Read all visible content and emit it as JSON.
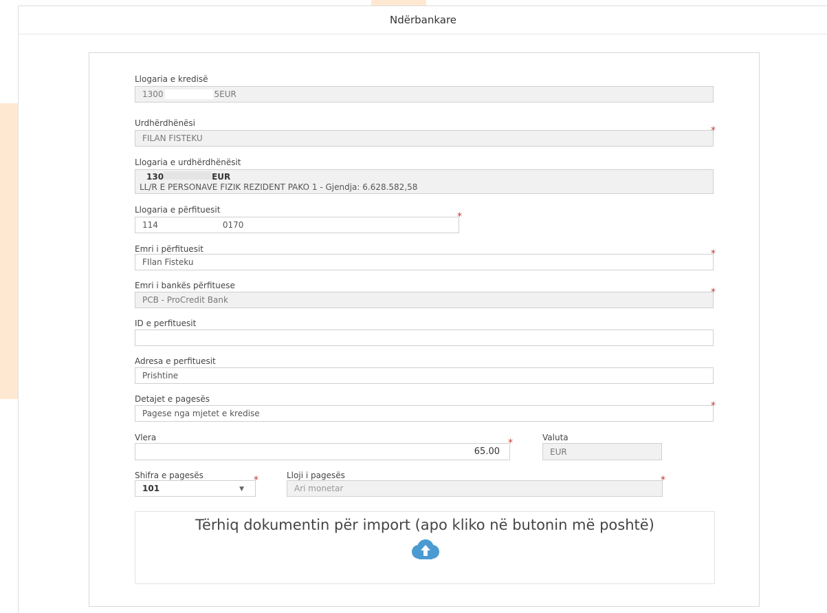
{
  "window": {
    "title": "Ndërbankare"
  },
  "form": {
    "credit_account": {
      "label": "Llogaria e kredisë",
      "value_start": "1300",
      "value_end": "5EUR"
    },
    "ordering_party": {
      "label": "Urdhërdhënësi",
      "value": "FILAN FISTEKU"
    },
    "ordering_account": {
      "label": "Llogaria e urdhërdhënësit",
      "account": "130",
      "account_suffix": "EUR",
      "description": "LL/R E PERSONAVE FIZIK REZIDENT PAKO 1 - Gjendja: 6.628.582,58"
    },
    "beneficiary_account": {
      "label": "Llogaria e përfituesit",
      "value_start": "114",
      "value_end": "0170"
    },
    "beneficiary_name": {
      "label": "Emri i përfituesit",
      "value": "FIlan Fisteku"
    },
    "beneficiary_bank": {
      "label": "Emri i bankës përfituese",
      "value": "PCB - ProCredit Bank"
    },
    "beneficiary_id": {
      "label": "ID e perfituesit",
      "value": ""
    },
    "beneficiary_address": {
      "label": "Adresa e perfituesit",
      "value": "Prishtine"
    },
    "payment_details": {
      "label": "Detajet e pagesës",
      "value": "Pagese nga mjetet e kredise"
    },
    "amount": {
      "label": "Vlera",
      "value": "65.00"
    },
    "currency": {
      "label": "Valuta",
      "value": "EUR"
    },
    "payment_code": {
      "label": "Shifra e pagesës",
      "value": "101"
    },
    "payment_type": {
      "label": "Lloji i pagesës",
      "value": "Ari monetar"
    }
  },
  "upload": {
    "text": "Tërhiq dokumentin për import (apo kliko në butonin më poshtë)",
    "icon": "cloud-upload-icon"
  },
  "colors": {
    "required_marker": "#c0392b",
    "cloud_icon": "#4a9bd1",
    "accent_stripe": "#ffe8d2"
  }
}
